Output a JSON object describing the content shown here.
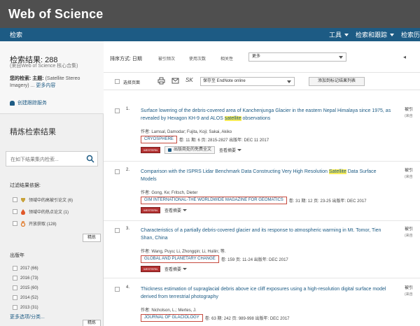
{
  "header": {
    "brand": "Web of Science",
    "nav_left": "检索",
    "nav_right": [
      "工具",
      "检索和跟踪",
      "检索历"
    ]
  },
  "sidebar": {
    "result_title": "检索结果: 288",
    "result_sub": "(来自Web of Science 核心合集)",
    "current_search_label": "您的检索: 主题:",
    "current_search_value": "(Satellite Stereo Imagery) ...",
    "more_link": "更多内容",
    "alert_link": "创建跟踪服务",
    "refine_title": "精炼检索结果",
    "refine_placeholder": "在如下结果集内检索...",
    "filter_title": "过滤结果依据:",
    "filters": [
      {
        "label": "领域中的高被引论文 (6)",
        "icon": "trophy-icon"
      },
      {
        "label": "领域中的热点论文 (1)",
        "icon": "fire-icon"
      },
      {
        "label": "开放获取 (128)",
        "icon": "open-access-icon"
      }
    ],
    "refine_button": "精炼",
    "year_title": "出版年",
    "years": [
      "2017 (66)",
      "2016 (73)",
      "2015 (60)",
      "2014 (52)",
      "2013 (31)"
    ],
    "more_options": "更多选项/分类...",
    "refine_button_2": "精炼"
  },
  "main": {
    "sort_label": "排序方式: 日期",
    "sort_options": [
      "被引频次",
      "使用次数",
      "相关性"
    ],
    "sort_select": "更多",
    "toolbar": {
      "select_page": "选择页面",
      "sk": "SK",
      "save_select": "保存至 EndNote online",
      "add_list": "添加到标记结果列表"
    },
    "records": [
      {
        "num": "1.",
        "title_pre": "Surface lowering of the debris-covered area of Kanchenjunga Glacier in the eastern Nepal Himalaya since 1975, as revealed by Hexagon KH-9 and ALOS ",
        "title_hl": "satellite",
        "title_post": " observations",
        "authors": "作者: Lamsal, Damodar; Fujita, Koji; Sakai, Akiko",
        "journal": "CRYOSPHERE",
        "src_rest": "卷: 11 期: 6 页: 2815-2827 出版年: DEC 11 2017",
        "fulltext": "出版商处的免费全文",
        "abstract": "查看摘要",
        "cited": "被引",
        "cited_sub": "(来自"
      },
      {
        "num": "2.",
        "title_pre": "Comparison with the ISPRS Lidar Benchmark Data Constructing Very High Resolution ",
        "title_hl": "Satellite",
        "title_post": " Data Surface Models",
        "authors": "作者: Gong, Ke; Fritsch, Dieter",
        "journal": "GIM INTERNATIONAL-THE WORLDWIDE MAGAZINE FOR GEOMATICS",
        "src_rest": "卷: 31 期: 12 页: 23-25 出版年: DEC 2017",
        "abstract": "查看摘要",
        "cited": "被引",
        "cited_sub": "(来自"
      },
      {
        "num": "3.",
        "title_pre": "Characteristics of a partially debris-covered glacier and its response to atmospheric warming in Mt. Tomor, Tien Shan, China",
        "title_hl": "",
        "title_post": "",
        "authors": "作者: Wang, Puyu; Li, Zhongqin; Li, Huilin; 等.",
        "journal": "GLOBAL AND PLANETARY CHANGE",
        "src_rest": "卷: 159 页: 11-24 出版年: DEC 2017",
        "abstract": "查看摘要",
        "cited": "被引",
        "cited_sub": "(来自"
      },
      {
        "num": "4.",
        "title_pre": "Thickness estimation of supraglacial debris above ice cliff exposures using a high-resolution digital surface model derived from terrestrial photography",
        "title_hl": "",
        "title_post": "",
        "authors": "作者: Nicholson, L.; Mertes, J.",
        "journal": "JOURNAL OF GLACIOLOGY",
        "src_rest": "卷: 63 期: 242 页: 989-998 出版年: DEC 2017",
        "cited": "被引",
        "cited_sub": "(来自"
      }
    ]
  },
  "colors": {
    "brand_bar": "#4f4f4f",
    "nav_bar": "#1d5b84",
    "link": "#1d5b84",
    "highlight": "#f7ec59",
    "journal_box": "#c64a3e"
  }
}
